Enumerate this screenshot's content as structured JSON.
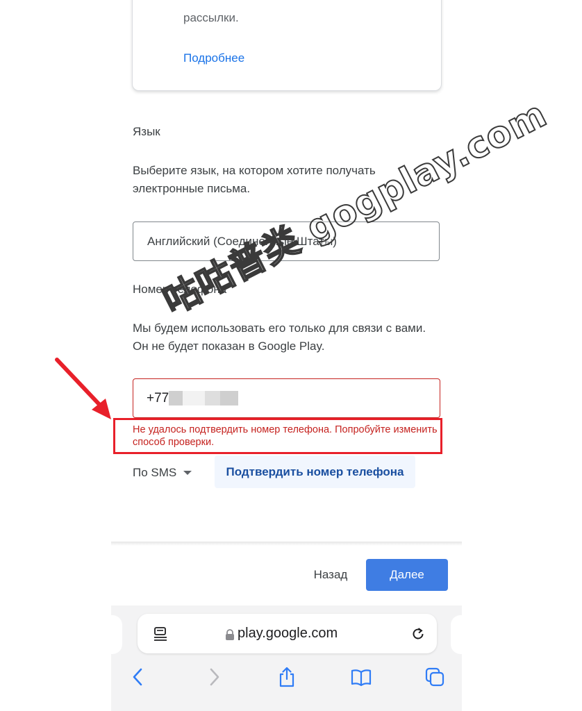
{
  "card": {
    "tail_text": "рассылки.",
    "more_link": "Подробнее"
  },
  "language": {
    "label": "Язык",
    "description": "Выберите язык, на котором хотите получать электронные письма.",
    "selected": "Английский (Соединенные Штаты)"
  },
  "phone": {
    "label": "Номер телефона",
    "description": "Мы будем использовать его только для связи с вами. Он не будет показан в Google Play.",
    "value_prefix": "+77",
    "error": "Не удалось подтвердить номер телефона. Попробуйте изменить способ проверки.",
    "method": "По SMS",
    "verify_button": "Подтвердить номер телефона"
  },
  "actions": {
    "back": "Назад",
    "next": "Далее"
  },
  "browser": {
    "url": "play.google.com"
  },
  "watermark": "咕咕普类 gogplay.com",
  "colors": {
    "accent": "#1a73e8",
    "primary_button": "#3f7de3",
    "error": "#c5221f",
    "annotation_red": "#e8202a"
  }
}
